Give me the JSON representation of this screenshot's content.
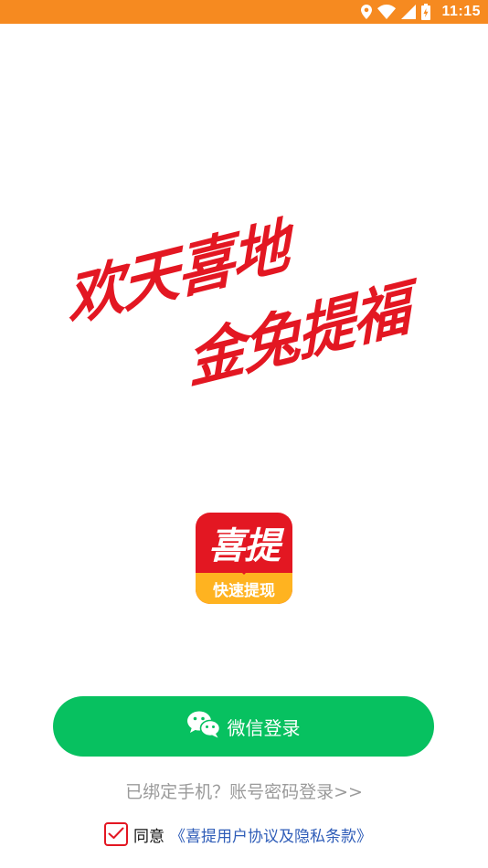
{
  "status_bar": {
    "time": "11:15",
    "background": "#f68a20"
  },
  "slogan": {
    "line1": "欢天喜地",
    "line2": "金兔提福",
    "color": "#e31722"
  },
  "app_icon": {
    "title": "喜提",
    "subtitle": "快速提现",
    "primary_color": "#e31722",
    "secondary_color": "#ffb320"
  },
  "wechat_login": {
    "label": "微信登录",
    "icon": "wechat-icon",
    "color": "#07c160"
  },
  "account_login": {
    "label": "已绑定手机？账号密码登录>>"
  },
  "agreement": {
    "checked": true,
    "prefix": "同意",
    "link_text": "《喜提用户协议及隐私条款》"
  }
}
